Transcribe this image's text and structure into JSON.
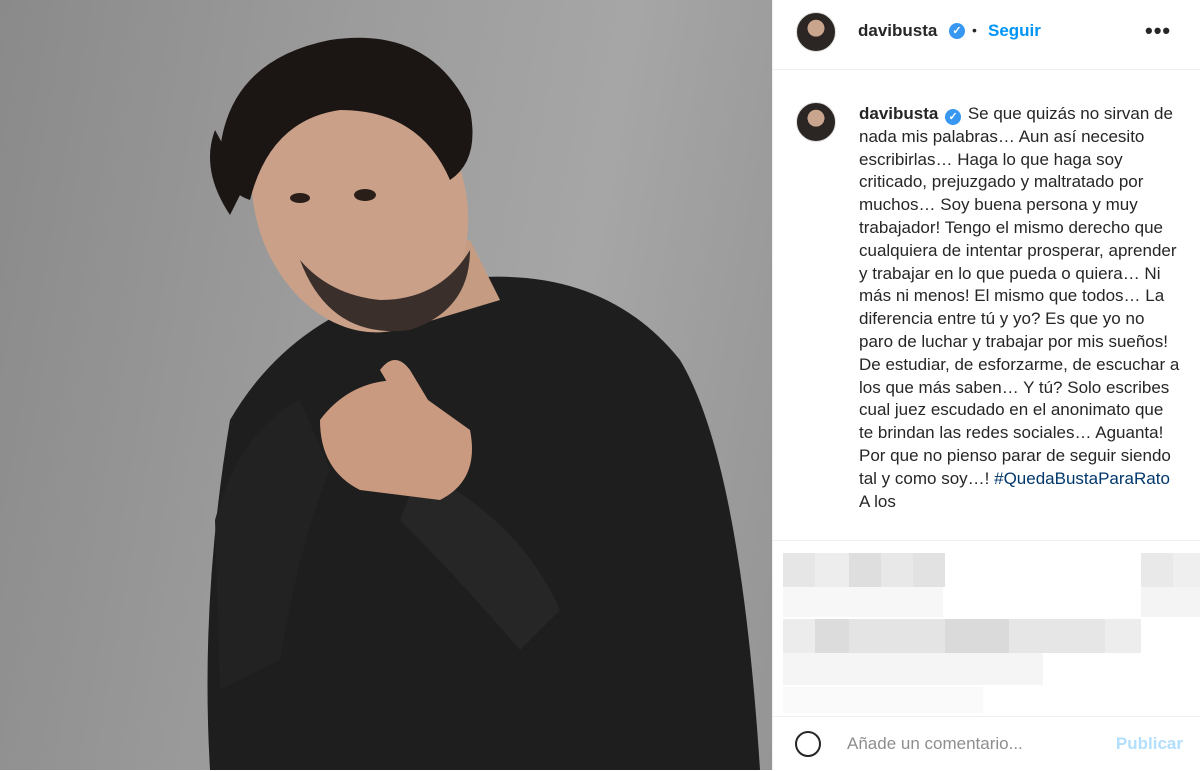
{
  "post": {
    "username": "davibusta",
    "follow_label": "Seguir",
    "separator": "•",
    "more_label": "•••",
    "verified_glyph": "✓",
    "caption_username": "davibusta",
    "caption_text": "Se que quizás no sirvan de nada mis palabras… Aun así necesito escribirlas… Haga lo que haga soy criticado, prejuzgado y maltratado por muchos… Soy buena persona y muy trabajador! Tengo el mismo derecho que cualquiera de intentar prosperar, aprender y trabajar en lo que pueda o quiera… Ni más ni menos! El mismo que todos… La diferencia entre tú y yo? Es que yo no paro de luchar y trabajar por mis sueños! De estudiar, de esforzarme, de escuchar a los que más saben… Y tú? Solo escribes cual juez escudado en el anonimato que te brindan las redes sociales… Aguanta! Por que no pienso parar de seguir siendo tal y como soy…!",
    "caption_hashtag": "#QuedaBustaParaRato",
    "caption_tail": " A los"
  },
  "comment_box": {
    "placeholder": "Añade un comentario...",
    "publish_label": "Publicar"
  },
  "icons": {
    "verified": "verified-badge-icon",
    "emoji": "emoji-icon",
    "more": "more-options-icon"
  },
  "colors": {
    "link_blue": "#0095f6",
    "verified_blue": "#3897f0",
    "hashtag": "#00376b",
    "text": "#262626"
  }
}
